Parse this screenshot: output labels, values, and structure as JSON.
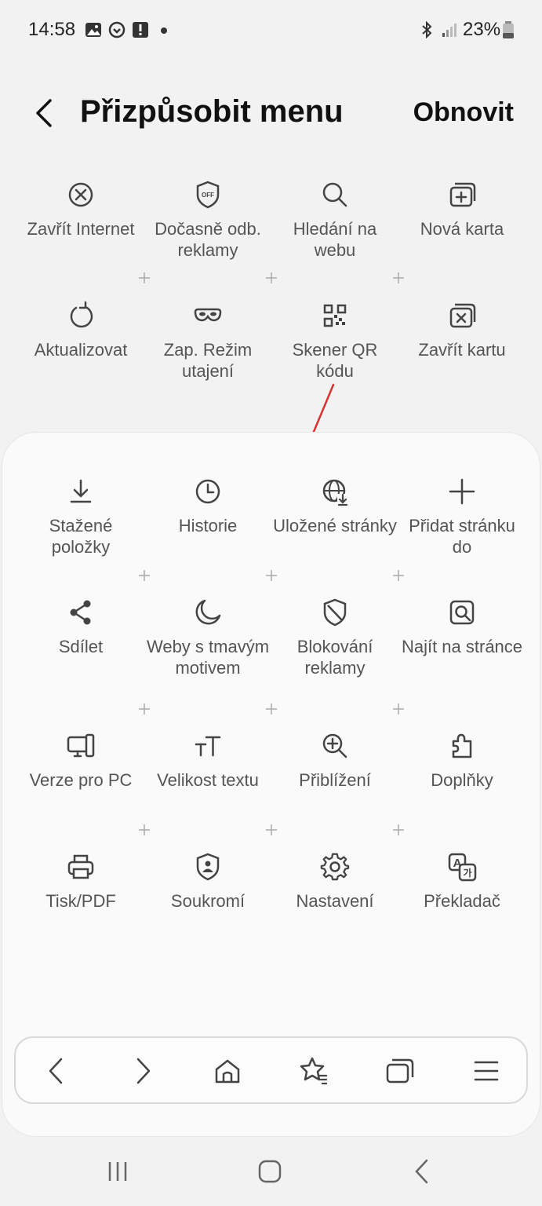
{
  "status_bar": {
    "time": "14:58",
    "battery": "23%",
    "icons": [
      "image-icon",
      "sync-icon",
      "alert-icon",
      "bluetooth-icon",
      "signal-icon",
      "battery-icon"
    ]
  },
  "header": {
    "title": "Přizpůsobit menu",
    "reset_label": "Obnovit"
  },
  "toolbar_items": [
    {
      "label": "Zavřít Internet",
      "icon": "close-circle-icon"
    },
    {
      "label": "Dočasně odb. reklamy",
      "icon": "ad-off-shield-icon"
    },
    {
      "label": "Hledání na webu",
      "icon": "search-icon"
    },
    {
      "label": "Nová karta",
      "icon": "new-tab-icon"
    },
    {
      "label": "Aktualizovat",
      "icon": "refresh-icon"
    },
    {
      "label": "Zap. Režim utajení",
      "icon": "secret-mask-icon"
    },
    {
      "label": "Skener QR kódu",
      "icon": "qr-code-icon"
    },
    {
      "label": "Zavřít kartu",
      "icon": "close-tab-icon"
    }
  ],
  "menu_items": [
    {
      "label": "Stažené položky",
      "icon": "download-icon"
    },
    {
      "label": "Historie",
      "icon": "clock-icon"
    },
    {
      "label": "Uložené stránky",
      "icon": "saved-pages-globe-icon"
    },
    {
      "label": "Přidat stránku do",
      "icon": "plus-icon"
    },
    {
      "label": "Sdílet",
      "icon": "share-icon"
    },
    {
      "label": "Weby s tmavým motivem",
      "icon": "moon-icon"
    },
    {
      "label": "Blokování reklamy",
      "icon": "ad-block-shield-icon"
    },
    {
      "label": "Najít na stránce",
      "icon": "find-on-page-icon"
    },
    {
      "label": "Verze pro PC",
      "icon": "desktop-icon"
    },
    {
      "label": "Velikost textu",
      "icon": "text-size-icon"
    },
    {
      "label": "Přiblížení",
      "icon": "zoom-in-icon"
    },
    {
      "label": "Doplňky",
      "icon": "puzzle-icon"
    },
    {
      "label": "Tisk/PDF",
      "icon": "printer-icon"
    },
    {
      "label": "Soukromí",
      "icon": "privacy-shield-icon"
    },
    {
      "label": "Nastavení",
      "icon": "gear-icon"
    },
    {
      "label": "Překladač",
      "icon": "translate-icon"
    }
  ],
  "bottom_toolbar": [
    "back-arrow-icon",
    "forward-arrow-icon",
    "home-icon",
    "bookmarks-star-icon",
    "tabs-icon",
    "menu-icon"
  ],
  "nav_bar": [
    "recent-apps-icon",
    "home-nav-icon",
    "back-nav-icon"
  ],
  "colors": {
    "annotation_arrow": "#d93030",
    "background": "#f2f2f2",
    "card": "#fafafa"
  }
}
